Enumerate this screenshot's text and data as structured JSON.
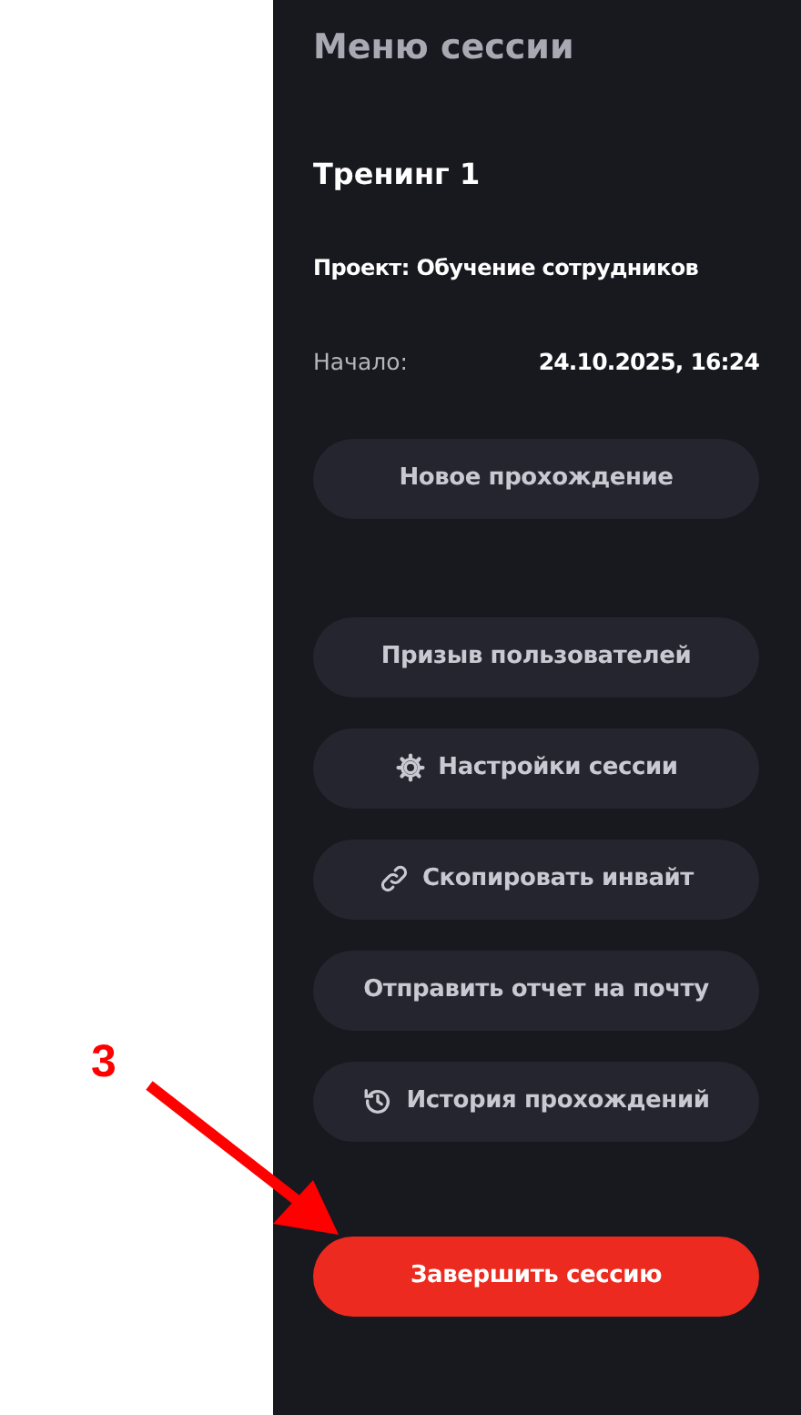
{
  "annotation": {
    "label": "3"
  },
  "panel": {
    "title": "Меню сессии",
    "session_name": "Тренинг 1",
    "project": "Проект: Обучение сотрудников",
    "start_label": "Начало:",
    "start_value": "24.10.2025, 16:24"
  },
  "primary_button": {
    "label": "Новое прохождение"
  },
  "actions": [
    {
      "label": "Призыв пользователей",
      "kind": "plain"
    },
    {
      "label": "Настройки сессии",
      "kind": "gear"
    },
    {
      "label": "Скопировать инвайт",
      "kind": "link"
    },
    {
      "label": "Отправить отчет на почту",
      "kind": "plain"
    },
    {
      "label": "История прохождений",
      "kind": "history"
    }
  ],
  "end_button": {
    "label": "Завершить сессию"
  }
}
